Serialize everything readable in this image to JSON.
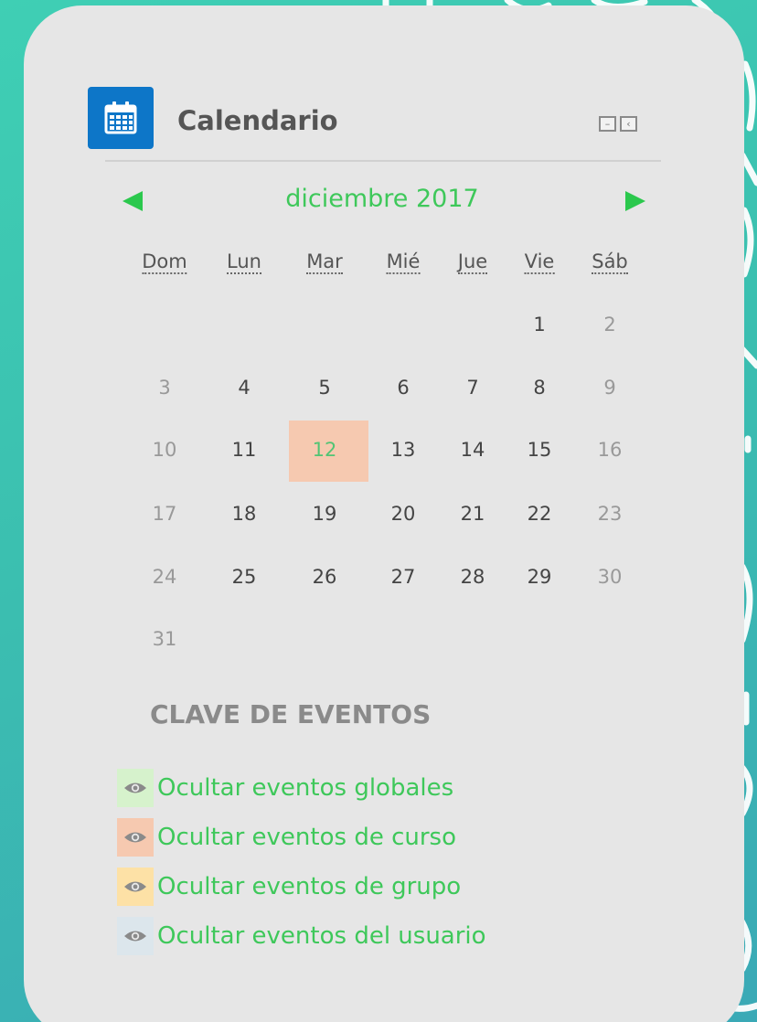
{
  "block": {
    "title": "Calendario",
    "icon": "calendar-icon",
    "controls": [
      {
        "name": "hide-block-icon",
        "glyph": "–"
      },
      {
        "name": "dock-block-icon",
        "glyph": "‹"
      }
    ]
  },
  "calendar": {
    "month_label": "diciembre 2017",
    "weekdays": [
      "Dom",
      "Lun",
      "Mar",
      "Mié",
      "Jue",
      "Vie",
      "Sáb"
    ],
    "weeks": [
      [
        "",
        "",
        "",
        "",
        "",
        "1",
        "2"
      ],
      [
        "3",
        "4",
        "5",
        "6",
        "7",
        "8",
        "9"
      ],
      [
        "10",
        "11",
        "12",
        "13",
        "14",
        "15",
        "16"
      ],
      [
        "17",
        "18",
        "19",
        "20",
        "21",
        "22",
        "23"
      ],
      [
        "24",
        "25",
        "26",
        "27",
        "28",
        "29",
        "30"
      ],
      [
        "31",
        "",
        "",
        "",
        "",
        "",
        ""
      ]
    ],
    "today": "12",
    "colors": {
      "nav_arrow": "#2bc84d",
      "month_text": "#3ec85a",
      "today_bg": "#f6c9b0"
    }
  },
  "event_key": {
    "title": "CLAVE DE EVENTOS",
    "items": [
      {
        "label": "Ocultar eventos globales",
        "color": "#d6f2cc",
        "icon": "eye-icon"
      },
      {
        "label": "Ocultar eventos de curso",
        "color": "#f6c9b0",
        "icon": "eye-icon"
      },
      {
        "label": "Ocultar eventos de grupo",
        "color": "#fde1a6",
        "icon": "eye-icon"
      },
      {
        "label": "Ocultar eventos del usuario",
        "color": "#dce6ec",
        "icon": "eye-icon"
      }
    ]
  }
}
